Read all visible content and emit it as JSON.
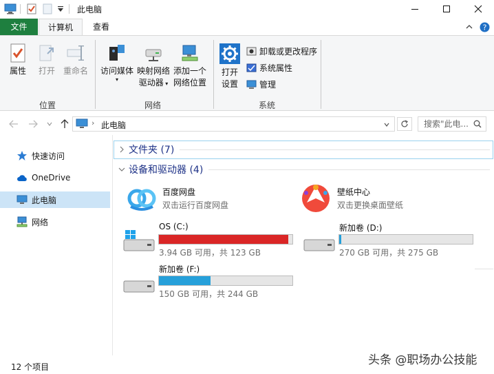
{
  "window": {
    "title": "此电脑"
  },
  "tabs": [
    {
      "label": "文件"
    },
    {
      "label": "计算机"
    },
    {
      "label": "查看"
    }
  ],
  "ribbon": {
    "location": {
      "properties": "属性",
      "open": "打开",
      "rename": "重命名",
      "group": "位置"
    },
    "network": {
      "access_media": "访问媒体",
      "map_drive_1": "映射网络",
      "map_drive_2": "驱动器",
      "add_location_1": "添加一个",
      "add_location_2": "网络位置",
      "group": "网络"
    },
    "system": {
      "open_settings_1": "打开",
      "open_settings_2": "设置",
      "uninstall": "卸载或更改程序",
      "sys_properties": "系统属性",
      "manage": "管理",
      "group": "系统"
    }
  },
  "address": {
    "path": "此电脑",
    "search_placeholder": "搜索\"此电..."
  },
  "nav": {
    "items": [
      {
        "label": "快速访问"
      },
      {
        "label": "OneDrive"
      },
      {
        "label": "此电脑"
      },
      {
        "label": "网络"
      }
    ]
  },
  "content": {
    "folders_header": "文件夹 (7)",
    "devices_header": "设备和驱动器 (4)",
    "apps": [
      {
        "name": "百度网盘",
        "desc": "双击运行百度网盘"
      },
      {
        "name": "壁纸中心",
        "desc": "双击更换桌面壁纸"
      }
    ],
    "drives": [
      {
        "name": "OS (C:)",
        "free": "3.94 GB 可用，共 123 GB",
        "used_fraction": 0.968,
        "color": "#da2626"
      },
      {
        "name": "新加卷 (D:)",
        "free": "270 GB 可用，共 275 GB",
        "used_fraction": 0.018,
        "color": "#26a0da"
      },
      {
        "name": "新加卷 (F:)",
        "free": "150 GB 可用，共 244 GB",
        "used_fraction": 0.385,
        "color": "#26a0da"
      }
    ]
  },
  "status": {
    "count": "12 个项目"
  },
  "watermark": "头条 @职场办公技能",
  "colors": {
    "file_tab": "#1e7f3f",
    "selection": "#cce4f7",
    "header_text": "#1e3287",
    "bar_full": "#da2626",
    "bar_normal": "#26a0da"
  }
}
